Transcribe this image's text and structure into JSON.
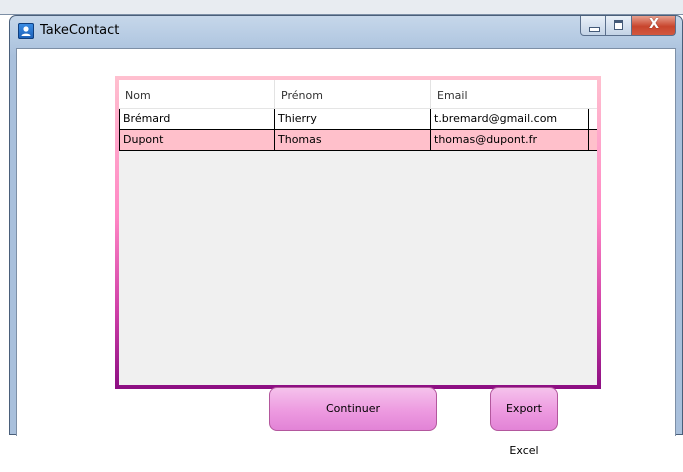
{
  "window": {
    "title": "TakeContact"
  },
  "icons": {
    "app": "contact-card-icon",
    "minimize": "minimize-icon",
    "maximize": "maximize-icon",
    "close": "close-icon"
  },
  "caption": {
    "close_glyph": "X"
  },
  "grid": {
    "columns": [
      "Nom",
      "Prénom",
      "Email"
    ],
    "rows": [
      {
        "nom": "Brémard",
        "prenom": "Thierry",
        "email": "t.bremard@gmail.com"
      },
      {
        "nom": "Dupont",
        "prenom": "Thomas",
        "email": "thomas@dupont.fr"
      }
    ],
    "colors": {
      "frame_top": "#ffc0cf",
      "frame_bottom": "#8c0e82",
      "selected_row": "#ffc0cb"
    }
  },
  "buttons": {
    "continue_label": "Continuer",
    "export_label": "Export Excel",
    "color": "#ed9ae0"
  }
}
